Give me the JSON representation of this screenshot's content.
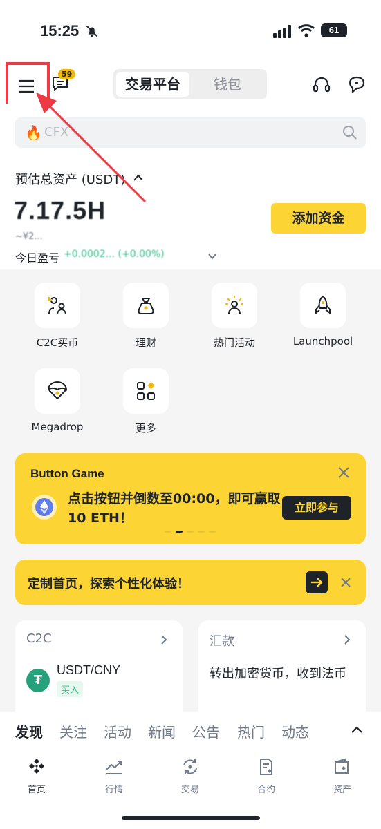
{
  "status_bar": {
    "time": "15:25",
    "battery": "61"
  },
  "header": {
    "badge_count": "59",
    "tabs": [
      {
        "label": "交易平台"
      },
      {
        "label": "钱包"
      }
    ]
  },
  "search": {
    "placeholder": "CFX"
  },
  "assets": {
    "label": "预估总资产 (USDT)",
    "value": "7.17.5H",
    "sub_value": "~¥2...",
    "pnl_label": "今日盈亏",
    "pnl_value": "+0.0002... (+0.00%)",
    "add_funds_label": "添加资金"
  },
  "quick_actions": [
    {
      "label": "C2C买币",
      "icon": "c2c-users-icon"
    },
    {
      "label": "理财",
      "icon": "money-bag-icon"
    },
    {
      "label": "热门活动",
      "icon": "hot-event-icon"
    },
    {
      "label": "Launchpool",
      "icon": "rocket-icon"
    },
    {
      "label": "Megadrop",
      "icon": "parachute-icon"
    },
    {
      "label": "更多",
      "icon": "more-grid-icon"
    }
  ],
  "banner_game": {
    "title": "Button Game",
    "text": "点击按钮并倒数至00:00，即可赢取10 ETH！",
    "cta": "立即参与"
  },
  "banner_customize": {
    "text": "定制首页，探索个性化体验！"
  },
  "cards": {
    "c2c": {
      "title": "C2C",
      "pair": "USDT/CNY",
      "tag": "买入"
    },
    "remit": {
      "title": "汇款",
      "text": "转出加密货币，收到法币"
    }
  },
  "feed_tabs": [
    "发现",
    "关注",
    "活动",
    "新闻",
    "公告",
    "热门",
    "动态"
  ],
  "bottom_nav": [
    {
      "label": "首页"
    },
    {
      "label": "行情"
    },
    {
      "label": "交易"
    },
    {
      "label": "合约"
    },
    {
      "label": "资产"
    }
  ],
  "colors": {
    "brand_yellow": "#fcd535",
    "accent_red": "#ee3a45",
    "up_green": "#2ebd85"
  }
}
